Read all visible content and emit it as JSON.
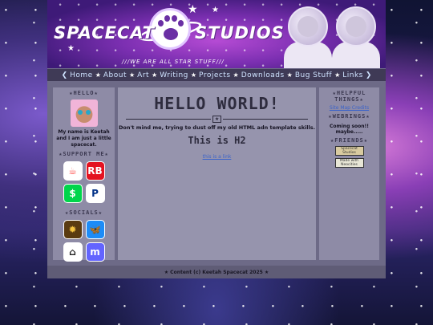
{
  "banner": {
    "brand_left": "SPACECAT",
    "brand_right": "STUDIOS",
    "tagline": "///WE ARE ALL STAR STUFF///"
  },
  "nav": {
    "items": [
      "Home",
      "About",
      "Art",
      "Writing",
      "Projects",
      "Downloads",
      "Bug Stuff",
      "Links"
    ],
    "prev": "❮",
    "next": "❯",
    "separator": "★"
  },
  "left": {
    "hello_heading": "★HELLO★",
    "bio": "My name is Keetah and I am just a little spacecat.",
    "support_heading": "★SUPPORT ME★",
    "support_icons": [
      {
        "name": "kofi-icon",
        "glyph": "☕",
        "color": "#ffffff",
        "fg": "#ff5e5b"
      },
      {
        "name": "redbubble-icon",
        "glyph": "RB",
        "color": "#e41321",
        "fg": "#ffffff"
      },
      {
        "name": "cashapp-icon",
        "glyph": "$",
        "color": "#00d54b",
        "fg": "#ffffff"
      },
      {
        "name": "paypal-icon",
        "glyph": "P",
        "color": "#ffffff",
        "fg": "#003087"
      }
    ],
    "socials_heading": "★SOCIALS★",
    "social_icons": [
      {
        "name": "sunburst-icon",
        "glyph": "✹",
        "color": "#5a3b10",
        "fg": "#f5c542"
      },
      {
        "name": "bluesky-icon",
        "glyph": "🦋",
        "color": "#1d8cf8",
        "fg": "#ffffff"
      },
      {
        "name": "toyhouse-icon",
        "glyph": "⌂",
        "color": "#ffffff",
        "fg": "#222222"
      },
      {
        "name": "mastodon-icon",
        "glyph": "m",
        "color": "#6364ff",
        "fg": "#ffffff"
      }
    ]
  },
  "main": {
    "h1": "HELLO WORLD!",
    "ornament": "★",
    "paragraph": "Don't mind me, trying to dust off my old HTML adn template skills.",
    "h2": "This is H2",
    "link": "this is a link"
  },
  "right": {
    "helpful_heading": "★HELPFUL THINGS★",
    "sitemap": "Site Map Credits",
    "webrings_heading": "★WEBRINGS★",
    "webrings_text": "Coming soon!! maybe.....",
    "friends_heading": "★FRIENDS★",
    "friend_buttons": [
      "Spacecat Studios",
      "Made with Neocities"
    ]
  },
  "footer": {
    "text": "★ Content (c) Keetah Spacecat 2025 ★"
  }
}
